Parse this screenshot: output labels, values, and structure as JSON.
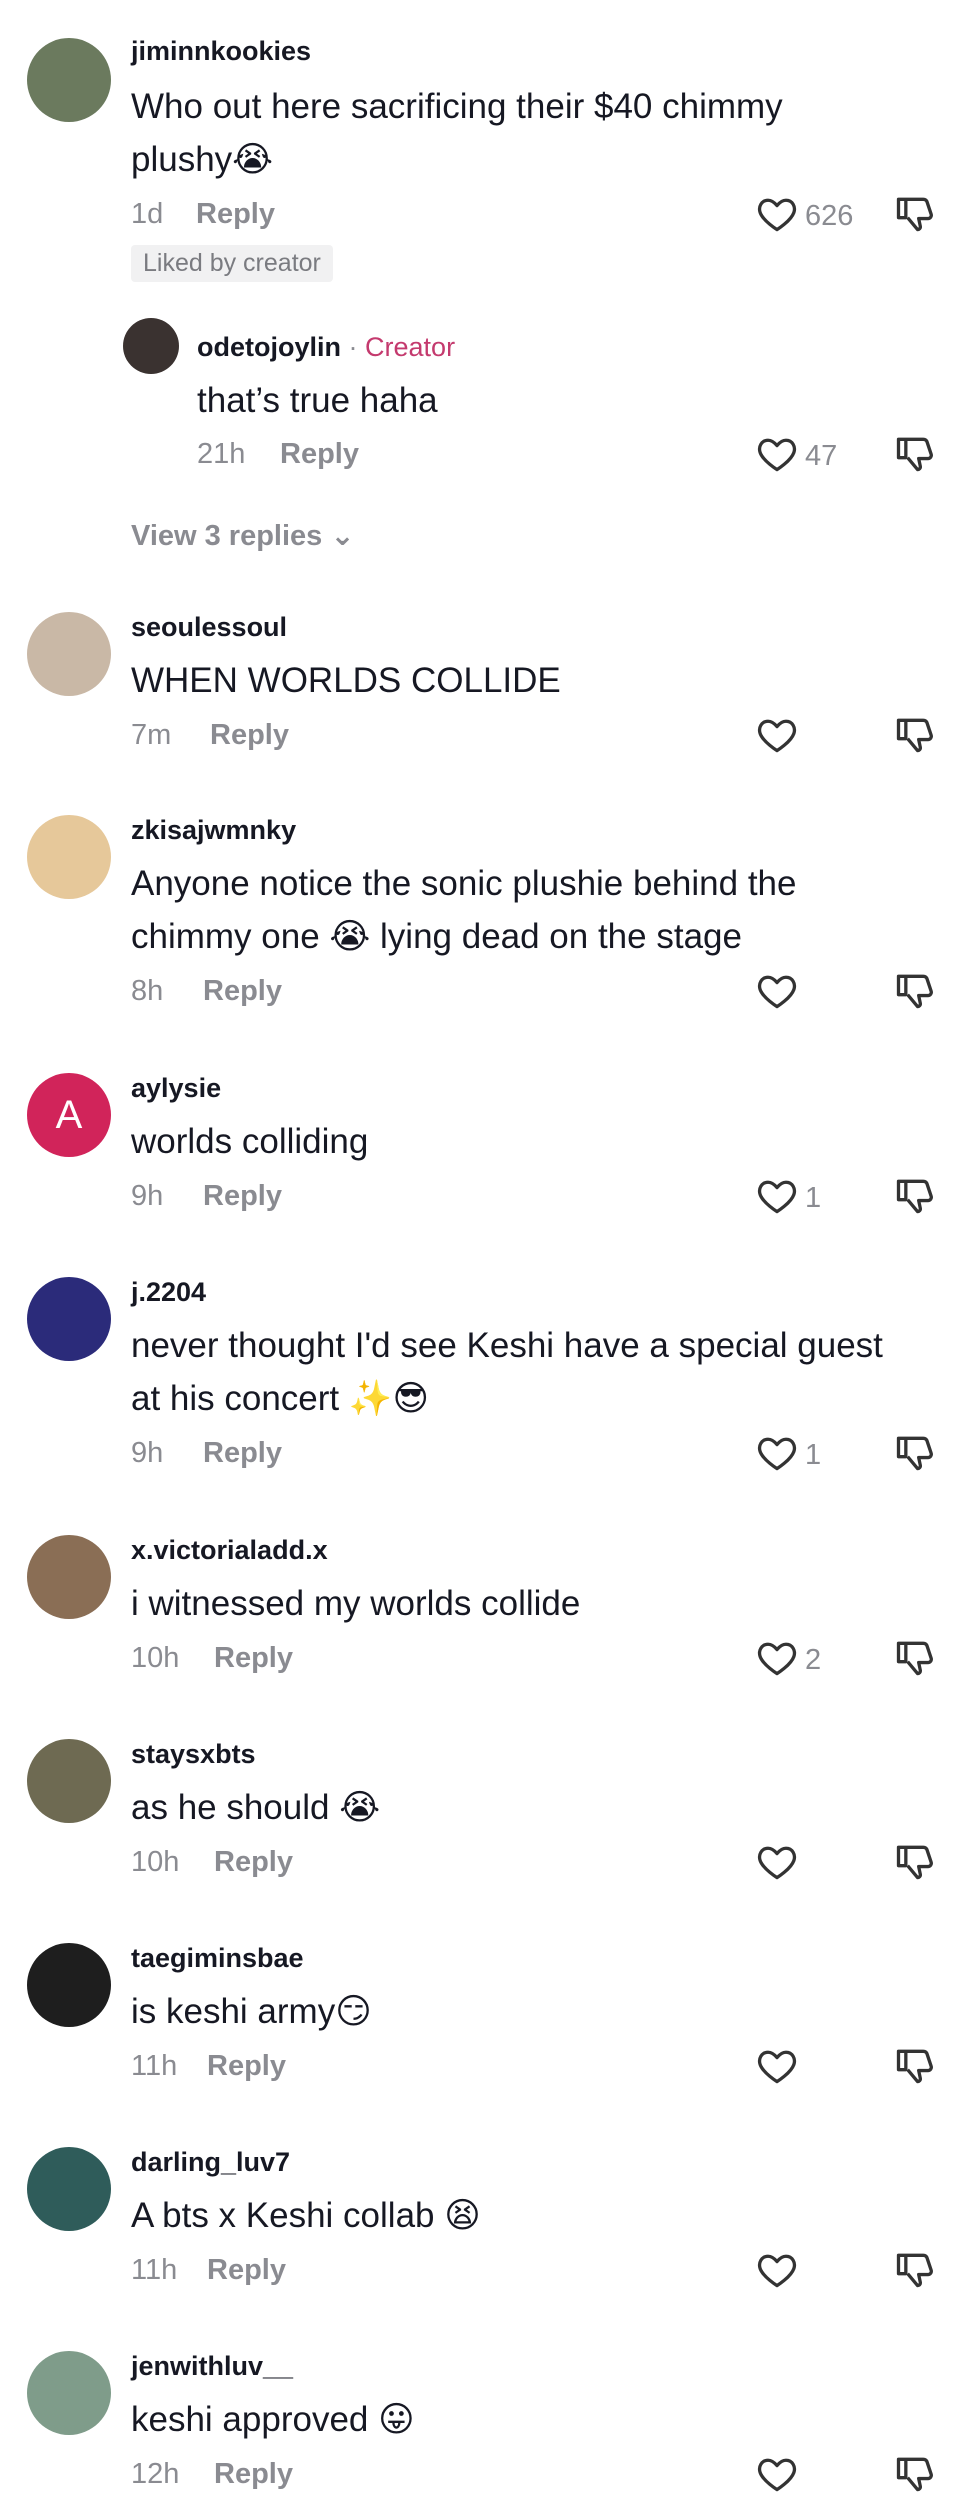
{
  "comments": [
    {
      "username": "jiminnkookies",
      "lines": [
        "Who out here sacrificing their $40 chimmy",
        "plushy😭"
      ],
      "time": "1d",
      "reply_label": "Reply",
      "likes": "626",
      "badge": "Liked by creator",
      "avatar_color": "#6b7a5e",
      "reply": {
        "username": "odetojoylin",
        "separator": "·",
        "creator_label": "Creator",
        "text": "that’s true haha",
        "time": "21h",
        "reply_label": "Reply",
        "likes": "47",
        "avatar_color": "#3a3230"
      },
      "view_replies": "View 3 replies ⌄"
    },
    {
      "username": "seoulessoul",
      "lines": [
        "WHEN WORLDS COLLIDE"
      ],
      "time": "7m",
      "reply_label": "Reply",
      "likes": "",
      "avatar_color": "#c9b8a6"
    },
    {
      "username": "zkisajwmnky",
      "lines": [
        "Anyone notice the sonic plushie behind the",
        "chimmy one 😭 lying dead on the stage"
      ],
      "time": "8h",
      "reply_label": "Reply",
      "likes": "",
      "avatar_color": "#e6c89a"
    },
    {
      "username": "aylysie",
      "lines": [
        "worlds colliding"
      ],
      "time": "9h",
      "reply_label": "Reply",
      "likes": "1",
      "avatar_color": "#d1245a",
      "avatar_letter": "A"
    },
    {
      "username": "j.2204",
      "lines": [
        "never thought I'd see Keshi have a special guest",
        "at his concert ✨😎"
      ],
      "time": "9h",
      "reply_label": "Reply",
      "likes": "1",
      "avatar_color": "#2b2b7a"
    },
    {
      "username": "x.victorialadd.x",
      "lines": [
        "i witnessed my worlds collide"
      ],
      "time": "10h",
      "reply_label": "Reply",
      "likes": "2",
      "avatar_color": "#8a6e55"
    },
    {
      "username": "staysxbts",
      "lines": [
        "as he should 😭"
      ],
      "time": "10h",
      "reply_label": "Reply",
      "likes": "",
      "avatar_color": "#6e6a52"
    },
    {
      "username": "taegiminsbae",
      "lines": [
        "is keshi army😏"
      ],
      "time": "11h",
      "reply_label": "Reply",
      "likes": "",
      "avatar_color": "#1e1e1e"
    },
    {
      "username": "darling_luv7",
      "lines": [
        "A bts x Keshi collab 😫"
      ],
      "time": "11h",
      "reply_label": "Reply",
      "likes": "",
      "avatar_color": "#2f5c5a"
    },
    {
      "username": "jenwithluv__",
      "lines": [
        "keshi approved 😛"
      ],
      "time": "12h",
      "reply_label": "Reply",
      "likes": "",
      "avatar_color": "#7f9c8a"
    }
  ],
  "icons": {
    "like": "heart-outline-icon",
    "dislike": "thumbs-down-outline-icon"
  }
}
